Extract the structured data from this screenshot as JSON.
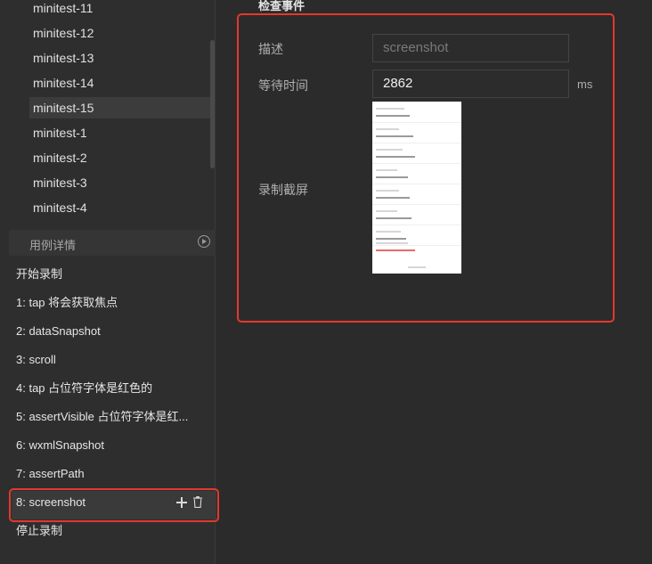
{
  "case_list": {
    "items": [
      "minitest-11",
      "minitest-12",
      "minitest-13",
      "minitest-14",
      "minitest-15",
      "minitest-1",
      "minitest-2",
      "minitest-3",
      "minitest-4"
    ],
    "active_index": 4
  },
  "detail": {
    "header_label": "用例详情"
  },
  "steps": {
    "start": "开始录制",
    "items": [
      "1: tap 将会获取焦点",
      "2: dataSnapshot",
      "3: scroll",
      "4: tap 占位符字体是红色的",
      "5: assertVisible 占位符字体是红...",
      "6: wxmlSnapshot",
      "7: assertPath",
      "8: screenshot"
    ],
    "stop": "停止录制"
  },
  "inspector": {
    "title": "检查事件",
    "description_label": "描述",
    "description_placeholder": "screenshot",
    "wait_label": "等待时间",
    "wait_value": "2862",
    "wait_unit": "ms",
    "screenshot_label": "录制截屏"
  },
  "colors": {
    "highlight": "#e4372f",
    "background": "#2b2b2b"
  }
}
